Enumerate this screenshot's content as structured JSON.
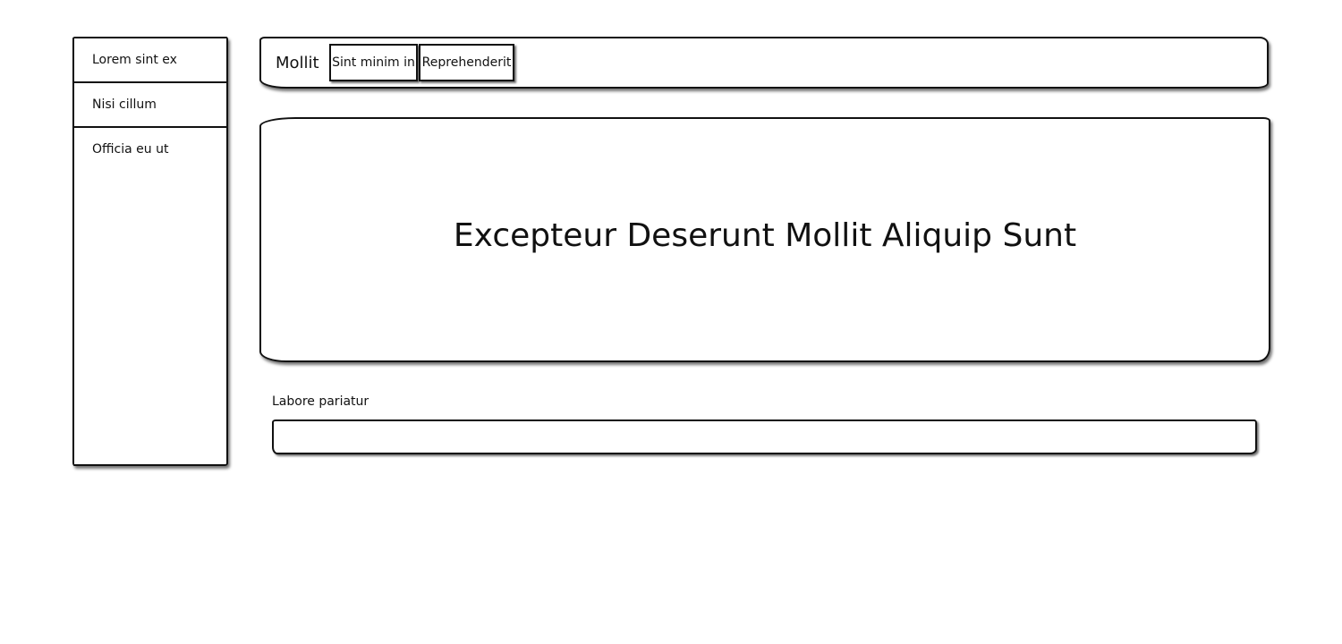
{
  "sidebar": {
    "items": [
      {
        "label": "Lorem sint ex"
      },
      {
        "label": "Nisi cillum"
      },
      {
        "label": "Officia eu ut"
      }
    ]
  },
  "navbar": {
    "brand": "Mollit",
    "tabs": [
      {
        "label": "Sint minim in"
      },
      {
        "label": "Reprehenderit"
      }
    ]
  },
  "hero": {
    "title": "Excepteur Deserunt Mollit Aliquip Sunt"
  },
  "form": {
    "label": "Labore pariatur",
    "value": "",
    "placeholder": ""
  }
}
